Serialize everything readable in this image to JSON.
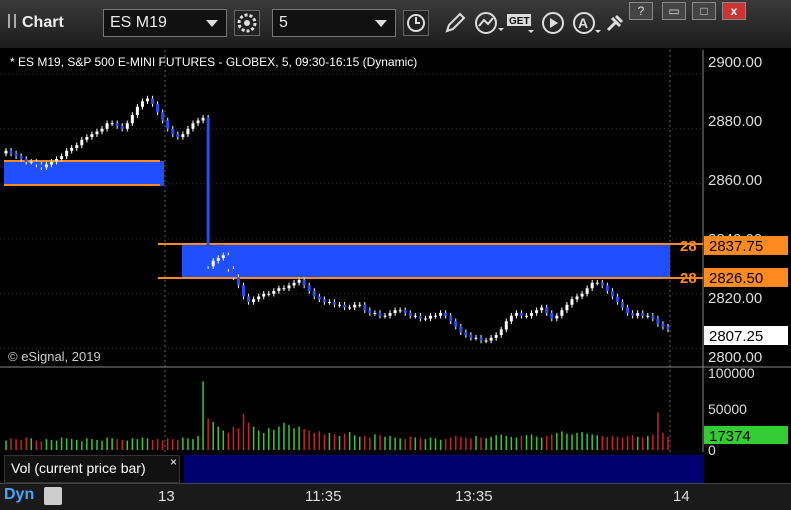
{
  "window": {
    "title": "Chart",
    "symbol": "ES M19",
    "interval": "5",
    "buttons": {
      "help": "?",
      "restore": "▭",
      "maximize": "□",
      "close": "x"
    }
  },
  "chart": {
    "info": "* ES M19, S&P 500 E-MINI FUTURES - GLOBEX, 5, 09:30-16:15 (Dynamic)",
    "copyright": "© eSignal, 2019",
    "price_axis": [
      "2900.00",
      "2880.00",
      "2860.00",
      "2840.00",
      "2820.00",
      "2800.00"
    ],
    "markers": {
      "upper": "2837.75",
      "lower": "2826.50",
      "last": "2807.25",
      "edge_upper": "28",
      "edge_lower": "28"
    },
    "colors": {
      "up": "#33cc33",
      "down": "#1f4fff",
      "zone": "#1f4fff",
      "zone_edge": "#ff8a1f",
      "vol_down": "#cc2222"
    }
  },
  "volume": {
    "axis": [
      "100000",
      "50000",
      "0"
    ],
    "last": "17374",
    "label": "Vol (current price bar)",
    "close": "×"
  },
  "time_axis": [
    "13",
    "11:35",
    "13:35",
    "14"
  ],
  "statusbar": {
    "mode": "Dyn"
  },
  "chart_data": {
    "type": "candlestick",
    "ylim": [
      2797,
      2905
    ],
    "close": [
      2872,
      2871,
      2870,
      2869,
      2868,
      2868,
      2867,
      2866,
      2867,
      2868,
      2869,
      2870,
      2872,
      2873,
      2874,
      2876,
      2877,
      2878,
      2879,
      2880,
      2882,
      2882,
      2881,
      2880,
      2882,
      2885,
      2888,
      2890,
      2891,
      2889,
      2886,
      2883,
      2880,
      2878,
      2877,
      2878,
      2880,
      2882,
      2883,
      2884,
      2830,
      2832,
      2833,
      2834,
      2829,
      2826,
      2823,
      2819,
      2817,
      2818,
      2819,
      2820,
      2820,
      2821,
      2822,
      2822,
      2823,
      2824,
      2825,
      2823,
      2821,
      2819,
      2818,
      2817,
      2817,
      2816,
      2816,
      2815,
      2815,
      2816,
      2816,
      2814,
      2813,
      2813,
      2812,
      2812,
      2813,
      2814,
      2814,
      2813,
      2812,
      2812,
      2811,
      2811,
      2812,
      2812,
      2813,
      2812,
      2810,
      2808,
      2806,
      2805,
      2804,
      2804,
      2803,
      2803,
      2804,
      2805,
      2807,
      2810,
      2812,
      2813,
      2812,
      2812,
      2813,
      2814,
      2815,
      2813,
      2811,
      2812,
      2814,
      2816,
      2818,
      2819,
      2820,
      2822,
      2824,
      2824,
      2823,
      2821,
      2819,
      2817,
      2815,
      2813,
      2812,
      2813,
      2812,
      2812,
      2811,
      2809,
      2808,
      2807
    ],
    "volume": [
      12000,
      15000,
      14000,
      13000,
      16000,
      15000,
      12000,
      11000,
      14000,
      13000,
      12000,
      16000,
      15000,
      14000,
      13000,
      11000,
      15000,
      14000,
      13000,
      12000,
      16000,
      15000,
      14000,
      13000,
      12000,
      15000,
      14000,
      16000,
      15000,
      13000,
      14000,
      12000,
      15000,
      14000,
      13000,
      16000,
      15000,
      14000,
      18000,
      88000,
      40000,
      36000,
      30000,
      25000,
      22000,
      30000,
      28000,
      46000,
      35000,
      30000,
      25000,
      22000,
      28000,
      26000,
      30000,
      35000,
      32000,
      28000,
      30000,
      27000,
      25000,
      22000,
      24000,
      20000,
      22000,
      20000,
      18000,
      21000,
      23000,
      19000,
      17000,
      18000,
      16000,
      20000,
      19000,
      17000,
      18000,
      16000,
      15000,
      14000,
      17000,
      16000,
      15000,
      14000,
      16000,
      15000,
      13000,
      14000,
      16000,
      18000,
      17000,
      16000,
      15000,
      18000,
      16000,
      15000,
      17000,
      19000,
      20000,
      18000,
      17000,
      16000,
      18000,
      19000,
      20000,
      17000,
      16000,
      18000,
      20000,
      22000,
      24000,
      21000,
      20000,
      22000,
      23000,
      21000,
      20000,
      19000,
      18000,
      17000,
      18000,
      17000,
      16000,
      18000,
      19000,
      17000,
      16000,
      18000,
      20000,
      48000,
      22000,
      17374
    ]
  }
}
